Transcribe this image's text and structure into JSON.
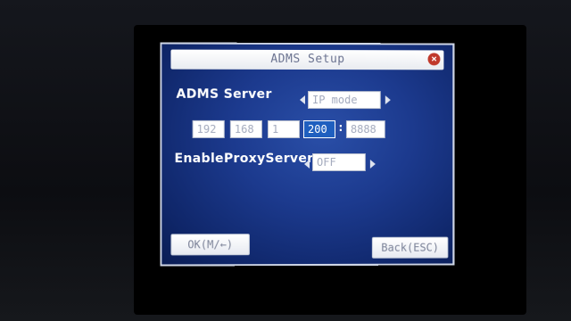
{
  "dialog": {
    "title": "ADMS Setup",
    "close_symbol": "×"
  },
  "adms_server": {
    "label": "ADMS Server",
    "mode_value": "IP mode",
    "ip_octets": [
      "192",
      "168",
      "1",
      "200"
    ],
    "port": "8888",
    "separator": ":",
    "selected_field": "ip_octet_4"
  },
  "proxy": {
    "label": "EnableProxyServer",
    "value": "OFF"
  },
  "buttons": {
    "ok_label": "OK(M/←)",
    "back_label": "Back(ESC)"
  },
  "colors": {
    "screen_background": "#1c3a8e",
    "selection": "#1f5fbf",
    "close_button": "#c0392b"
  }
}
